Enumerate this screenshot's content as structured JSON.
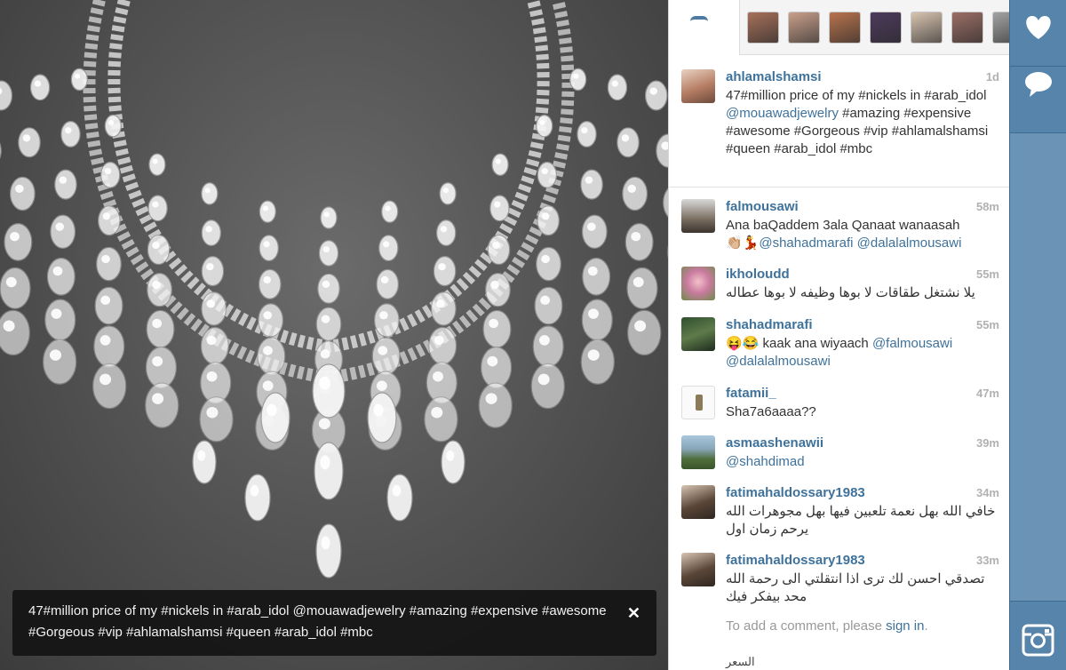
{
  "photo": {
    "caption": "47#million price of my #nickels in #arab_idol @mouawadjewelry #amazing #expensive #awesome #Gorgeous #vip #ahlamalshamsi #queen #arab_idol #mbc",
    "close_glyph": "✕"
  },
  "likers": {
    "tab_icon": "likes-icon",
    "avatar_colors": [
      "#a6705a",
      "#c9a08b",
      "#b8734d",
      "#4d3a5c",
      "#d8c4b0",
      "#9b6e66",
      "#a3a3a3"
    ]
  },
  "post": {
    "username": "ahlamalshamsi",
    "timestamp": "1d",
    "caption_segments": [
      {
        "t": "47#million price of my #nickels in #arab_idol ",
        "tag": false
      },
      {
        "t": "@mouawadjewelry",
        "tag": true
      },
      {
        "t": " #amazing #expensive #awesome #Gorgeous #vip #ahlamalshamsi #queen #arab_idol #mbc",
        "tag": false
      }
    ]
  },
  "comments": [
    {
      "username": "falmousawi",
      "time": "58m",
      "line1": "Ana baQaddem 3ala Qanaat wanaasah",
      "emoji": "👏🏼💃",
      "mention1": "@shahadmarafi",
      "mention2": "@dalalalmousawi"
    },
    {
      "username": "ikholoudd",
      "time": "55m",
      "text": "يلا نشتغل طقاقات لا بوها وظيفه لا بوها عطاله"
    },
    {
      "username": "shahadmarafi",
      "time": "55m",
      "emoji": "😝😂",
      "text": " kaak ana wiyaach ",
      "mention1": "@falmousawi",
      "mention2": "@dalalalmousawi"
    },
    {
      "username": "fatamii_",
      "time": "47m",
      "text": "Sha7a6aaaa??"
    },
    {
      "username": "asmaashenawii",
      "time": "39m",
      "mention1": "@shahdimad"
    },
    {
      "username": "fatimahaldossary1983",
      "time": "34m",
      "text": "خافي الله بهل نعمة تلعبين فيها بهل مجوهرات الله يرحم زمان اول"
    },
    {
      "username": "fatimahaldossary1983",
      "time": "33m",
      "text": "تصدقي احسن لك ترى اذا انتقلتي الى رحمة الله محد بيفكر فيك"
    }
  ],
  "signin": {
    "prefix": "To add a comment, please ",
    "link": "sign in",
    "suffix": "."
  },
  "partial_text": "السعر",
  "rail": {
    "like_icon": "heart-icon",
    "comment_icon": "comment-bubble-icon",
    "logo_icon": "instagram-camera-icon"
  }
}
